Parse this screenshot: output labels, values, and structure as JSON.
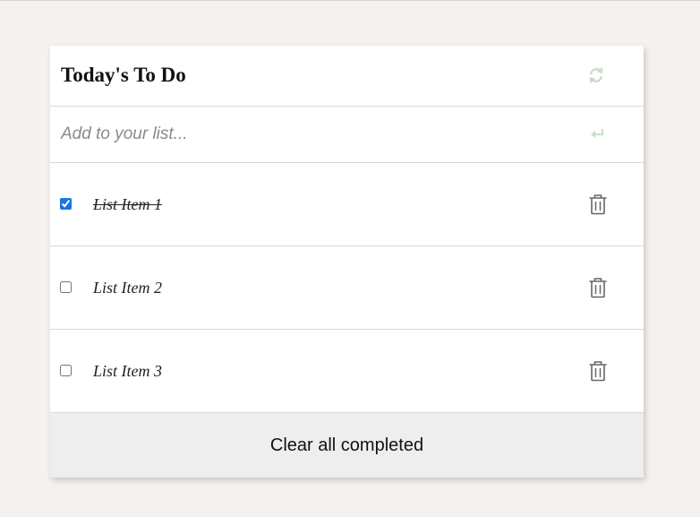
{
  "header": {
    "title": "Today's To Do",
    "refresh_icon": "refresh-icon"
  },
  "input": {
    "placeholder": "Add to your list...",
    "value": "",
    "enter_icon": "enter-icon"
  },
  "items": [
    {
      "label": "List Item 1",
      "completed": true,
      "delete_icon": "trash-icon"
    },
    {
      "label": "List Item 2",
      "completed": false,
      "delete_icon": "trash-icon"
    },
    {
      "label": "List Item 3",
      "completed": false,
      "delete_icon": "trash-icon"
    }
  ],
  "footer": {
    "clear_label": "Clear all completed"
  },
  "colors": {
    "page_bg": "#f4f1ef",
    "card_bg": "#ffffff",
    "footer_bg": "#eeeeee",
    "checkbox_accent": "#1a73e8",
    "faded_icon": "#c8dcc8",
    "trash_icon": "#666666"
  }
}
